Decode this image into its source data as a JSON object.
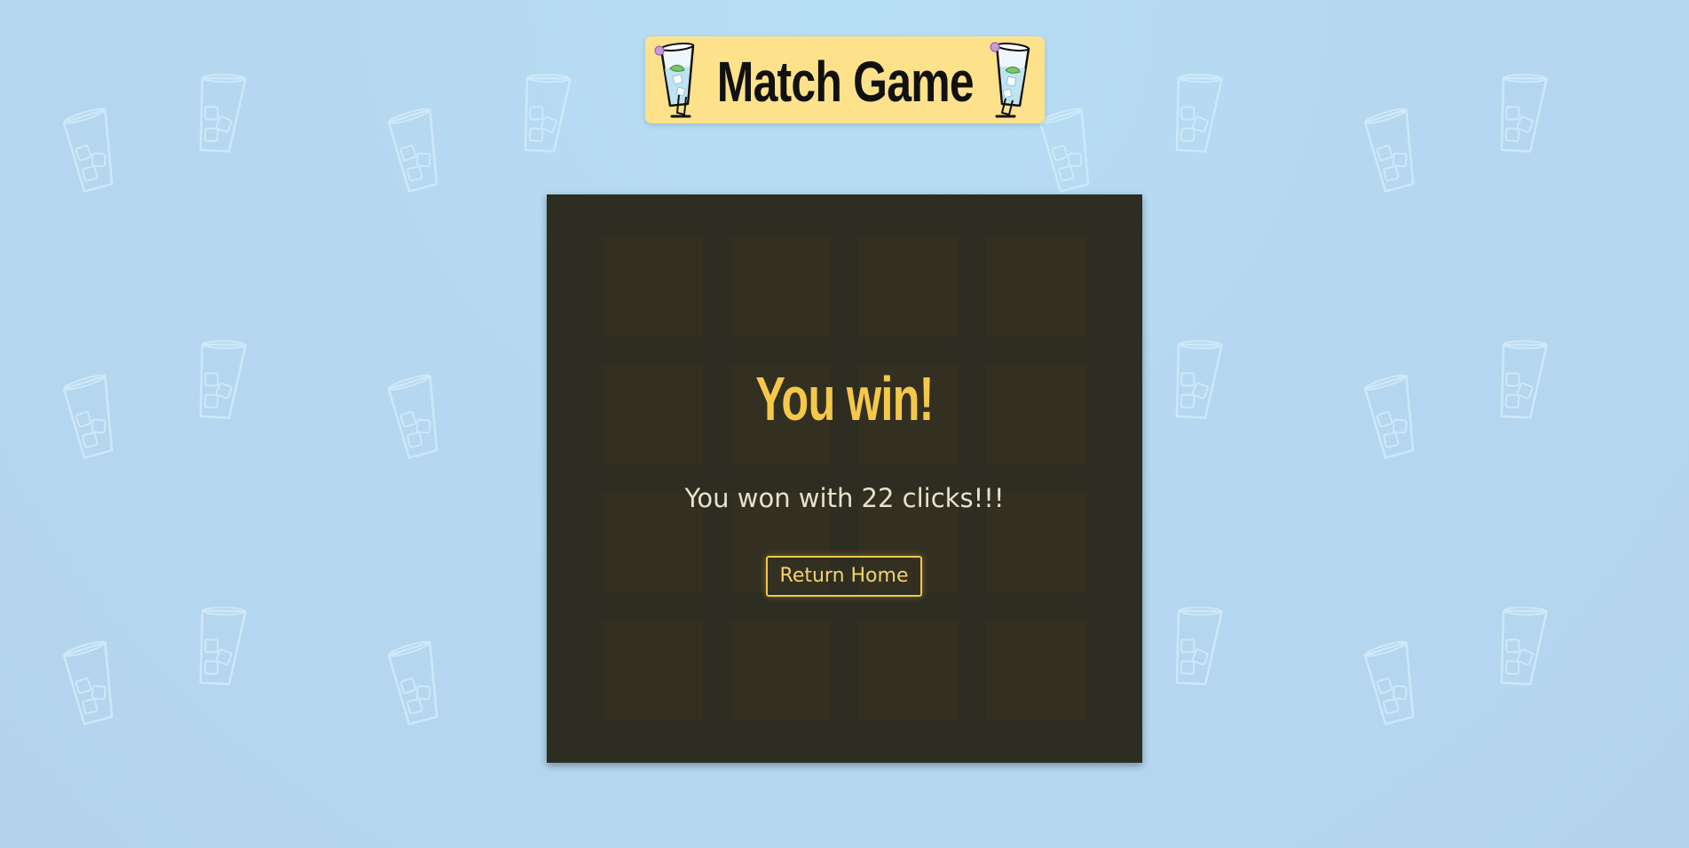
{
  "header": {
    "title": "Match Game",
    "left_icon": "cocktail-glass-icon",
    "right_icon": "cocktail-glass-icon"
  },
  "board": {
    "rows": 4,
    "columns": 4,
    "tile_count": 16
  },
  "win": {
    "title": "You win!",
    "message": "You won with 22 clicks!!!",
    "button_label": "Return Home"
  },
  "colors": {
    "background": "#b5d8f0",
    "banner": "#fde28b",
    "board": "#2d2d21",
    "tile": "#333022",
    "accent": "#f5c84a",
    "message_text": "#e8e2cc"
  },
  "background_icon": "drinking-glass-icon"
}
